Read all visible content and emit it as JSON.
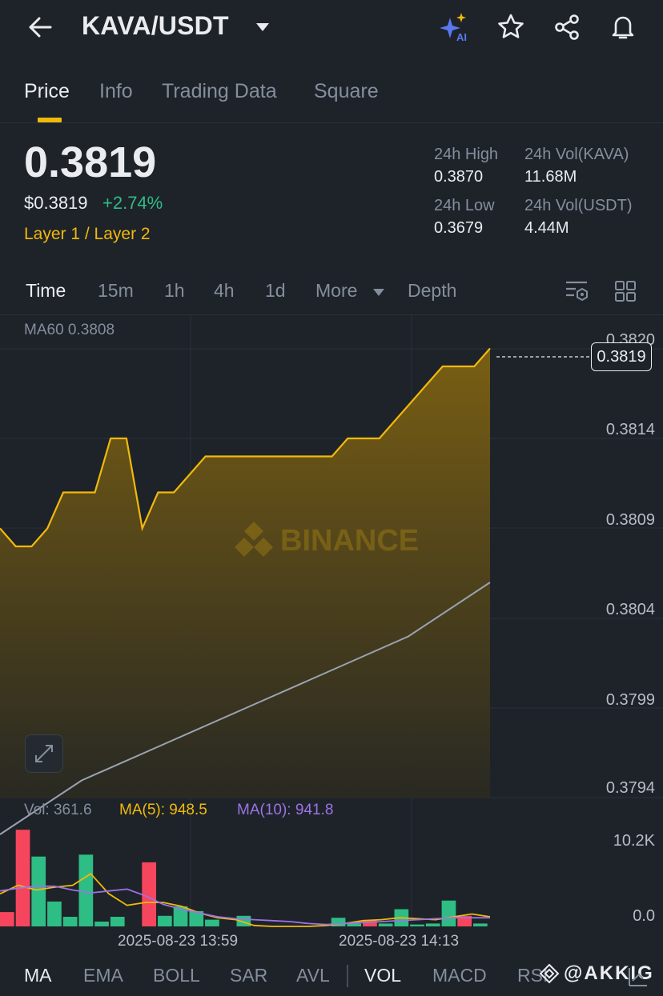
{
  "header": {
    "pair": "KAVA/USDT",
    "icons": [
      "back-arrow-icon",
      "dropdown-caret-icon",
      "ai-sparkle-icon",
      "star-icon",
      "share-icon",
      "bell-icon"
    ],
    "ai_badge": "AI"
  },
  "tabs": [
    {
      "label": "Price",
      "active": true
    },
    {
      "label": "Info",
      "active": false
    },
    {
      "label": "Trading Data",
      "active": false
    },
    {
      "label": "Square",
      "active": false
    }
  ],
  "ticker": {
    "last_price": "0.3819",
    "usd_price": "$0.3819",
    "change": "+2.74%",
    "sector": "Layer 1 / Layer 2",
    "high_label": "24h High",
    "high_value": "0.3870",
    "low_label": "24h Low",
    "low_value": "0.3679",
    "vol_base_label": "24h Vol(KAVA)",
    "vol_base_value": "11.68M",
    "vol_quote_label": "24h Vol(USDT)",
    "vol_quote_value": "4.44M"
  },
  "timeframes": [
    "Time",
    "15m",
    "1h",
    "4h",
    "1d",
    "More",
    "Depth"
  ],
  "chart": {
    "ma60_label": "MA60 0.3808",
    "price_axis": [
      "0.3820",
      "0.3814",
      "0.3809",
      "0.3804",
      "0.3799",
      "0.3794"
    ],
    "current_price_tag": "0.3819",
    "watermark": "BINANCE",
    "vol_label": "Vol: 361.6",
    "ma5_label": "MA(5): 948.5",
    "ma10_label": "MA(10): 941.8",
    "vol_axis_top": "10.2K",
    "vol_axis_bottom": "0.0",
    "time_labels": [
      "2025-08-23 13:59",
      "2025-08-23 14:13"
    ]
  },
  "chart_data": {
    "type": "area",
    "title": "",
    "ylim": [
      0.3792,
      0.3821
    ],
    "series": [
      {
        "name": "",
        "values": [
          0.3809,
          0.3808,
          0.3808,
          0.3809,
          0.3811,
          0.3811,
          0.3811,
          0.3814,
          0.3814,
          0.3809,
          0.3811,
          0.3811,
          0.3812,
          0.3813,
          0.3813,
          0.3813,
          0.3813,
          0.3813,
          0.3813,
          0.3813,
          0.3813,
          0.3813,
          0.3814,
          0.3814,
          0.3814,
          0.3815,
          0.3816,
          0.3817,
          0.3818,
          0.3818,
          0.3818,
          0.3819
        ]
      },
      {
        "name": "MA60",
        "values": [
          0.3792,
          0.3795,
          0.3797,
          0.3799,
          0.3801,
          0.3803,
          0.3806
        ]
      }
    ],
    "volume": {
      "ylim": [
        0,
        10200
      ],
      "bars": [
        {
          "v": 1500,
          "up": false
        },
        {
          "v": 10100,
          "up": false
        },
        {
          "v": 7300,
          "up": true
        },
        {
          "v": 2600,
          "up": true
        },
        {
          "v": 1000,
          "up": true
        },
        {
          "v": 7500,
          "up": true
        },
        {
          "v": 500,
          "up": true
        },
        {
          "v": 1000,
          "up": true
        },
        {
          "v": 0,
          "up": true
        },
        {
          "v": 6700,
          "up": false
        },
        {
          "v": 1100,
          "up": true
        },
        {
          "v": 2100,
          "up": true
        },
        {
          "v": 1600,
          "up": true
        },
        {
          "v": 700,
          "up": true
        },
        {
          "v": 0,
          "up": true
        },
        {
          "v": 1100,
          "up": true
        },
        {
          "v": 0,
          "up": true
        },
        {
          "v": 0,
          "up": true
        },
        {
          "v": 0,
          "up": true
        },
        {
          "v": 0,
          "up": true
        },
        {
          "v": 0,
          "up": true
        },
        {
          "v": 900,
          "up": true
        },
        {
          "v": 300,
          "up": true
        },
        {
          "v": 600,
          "up": false
        },
        {
          "v": 300,
          "up": true
        },
        {
          "v": 1800,
          "up": true
        },
        {
          "v": 200,
          "up": true
        },
        {
          "v": 300,
          "up": true
        },
        {
          "v": 2700,
          "up": true
        },
        {
          "v": 1100,
          "up": false
        },
        {
          "v": 300,
          "up": true
        }
      ],
      "ma5": [
        3400,
        4300,
        3800,
        4100,
        4300,
        5500,
        3400,
        2200,
        2500,
        2500,
        2100,
        1400,
        900,
        700,
        100,
        0,
        0,
        0,
        100,
        300,
        600,
        700,
        900,
        800,
        700,
        1000,
        1300,
        1000
      ],
      "ma10": [
        3700,
        4000,
        4200,
        4200,
        3800,
        3500,
        3700,
        3900,
        3200,
        2300,
        1800,
        1400,
        1000,
        800,
        700,
        600,
        500,
        300,
        200,
        300,
        400,
        500,
        600,
        700,
        800,
        900,
        900,
        900
      ]
    }
  },
  "indicators": [
    {
      "label": "MA",
      "active": true
    },
    {
      "label": "EMA",
      "active": false
    },
    {
      "label": "BOLL",
      "active": false
    },
    {
      "label": "SAR",
      "active": false
    },
    {
      "label": "AVL",
      "active": false
    },
    {
      "label": "VOL",
      "active": true
    },
    {
      "label": "MACD",
      "active": false
    },
    {
      "label": "RSI",
      "active": false
    }
  ],
  "watermark_handle": "@AKKIG",
  "colors": {
    "accent": "#f0b90b",
    "up": "#2ebd85",
    "down": "#f6465d",
    "ma10": "#9b73e6"
  }
}
